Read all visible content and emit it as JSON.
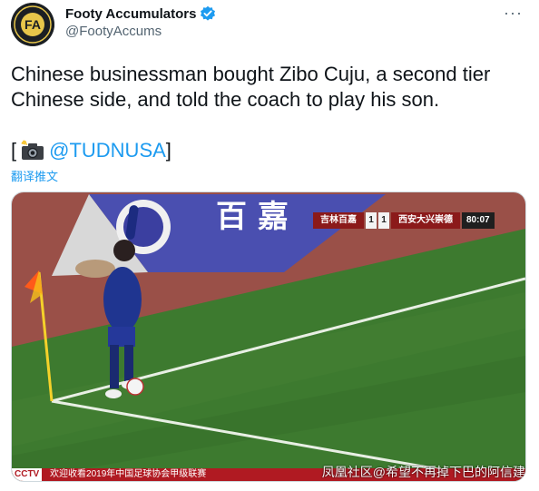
{
  "author": {
    "display_name": "Footy Accumulators",
    "handle": "@FootyAccums",
    "avatar_letters": "FA"
  },
  "menu": {
    "more_label": "···"
  },
  "tweet": {
    "text": "Chinese businessman bought Zibo Cuju, a second tier Chinese side, and told the coach to play his son.",
    "credit_open": "[",
    "credit_mention": "@TUDNUSA",
    "credit_close": "]",
    "translate_label": "翻译推文"
  },
  "media": {
    "scoreboard": {
      "home_team": "吉林百嘉",
      "home_score": "1",
      "away_score": "1",
      "away_team": "西安大兴崇德",
      "clock": "80:07"
    },
    "banner_text": "百 嘉",
    "ticker_station": "CCTV",
    "ticker_text": "欢迎收看2019年中国足球协会甲级联赛",
    "watermark": "凤凰社区@希望不再掉下巴的阿信建"
  },
  "colors": {
    "accent": "#1d9bf0",
    "pitch": "#3c7a2e",
    "track": "#a0564b",
    "banner": "#4a4fb0",
    "ticker": "#b01a22"
  },
  "icons": [
    "verified-badge-icon",
    "more-options-icon",
    "camera-flash-icon"
  ]
}
